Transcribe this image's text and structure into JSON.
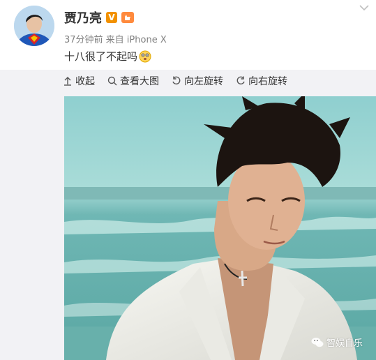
{
  "post": {
    "username": "贾乃亮",
    "verified_badge": "V",
    "meta": "37分钟前 来自 iPhone X",
    "text": "十八很了不起吗"
  },
  "toolbar": {
    "collapse": "收起",
    "view_large": "查看大图",
    "rotate_left": "向左旋转",
    "rotate_right": "向右旋转"
  },
  "watermark": {
    "text": "智娱自乐"
  },
  "colors": {
    "verified": "#f29100",
    "card_bg": "#f2f2f5",
    "meta_text": "#808080"
  }
}
